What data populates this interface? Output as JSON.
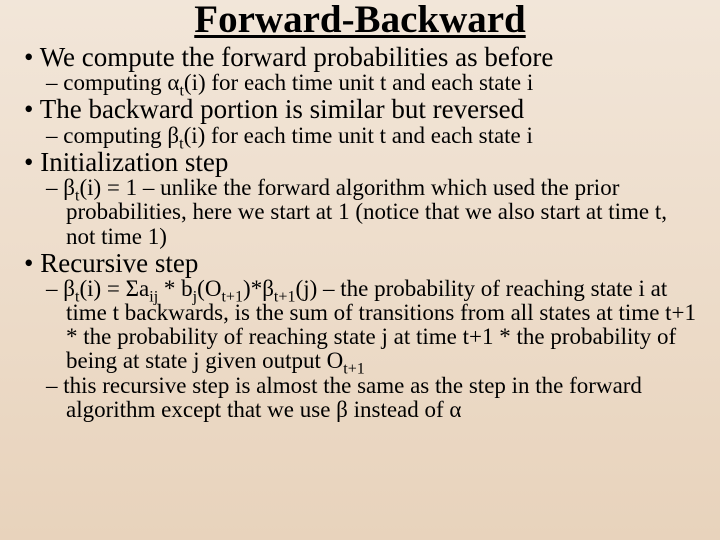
{
  "title": "Forward-Backward",
  "items": [
    {
      "text": "We compute the forward probabilities as before",
      "sub": [
        {
          "html": "computing α<sub>t</sub>(i) for each time unit t and each state i"
        }
      ]
    },
    {
      "text": "The backward portion is similar but reversed",
      "sub": [
        {
          "html": "computing β<sub>t</sub>(i) for each time unit t and each state i"
        }
      ]
    },
    {
      "text": "Initialization step",
      "sub": [
        {
          "html": "β<sub>t</sub>(i) = 1 – unlike the forward algorithm which used the prior probabilities, here we start at 1 (notice that we also start at time t, not time 1)"
        }
      ]
    },
    {
      "text": "Recursive step",
      "sub": [
        {
          "html": "β<sub>t</sub>(i) = Σa<sub>ij</sub> * b<sub>j</sub>(O<sub>t+1</sub>)*β<sub>t+1</sub>(j) – the probability of reaching state i at time t backwards, is the sum of transitions from all states at time t+1 * the probability of reaching state j at time t+1 * the probability of being at state j given output O<sub>t+1</sub>"
        },
        {
          "html": "this recursive step is almost the same as the step in the forward algorithm except that we use β instead of α"
        }
      ]
    }
  ]
}
